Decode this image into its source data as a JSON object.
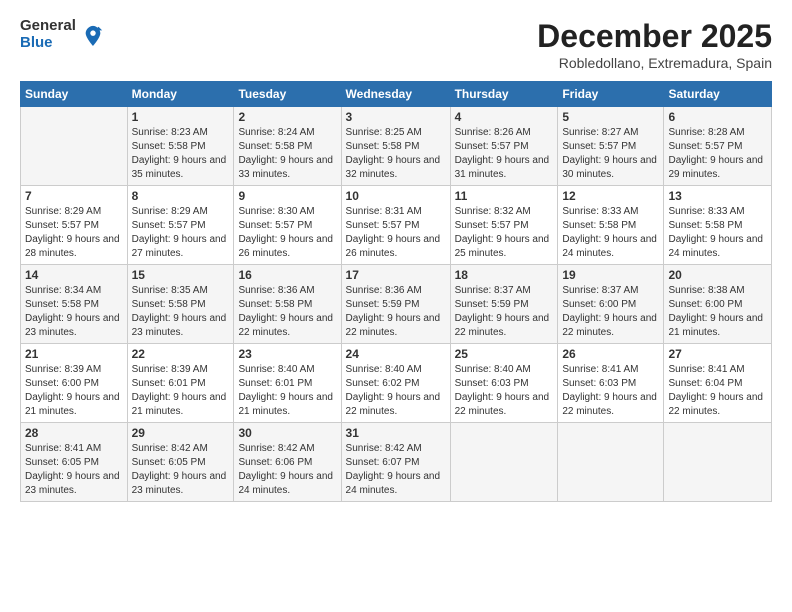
{
  "logo": {
    "general": "General",
    "blue": "Blue"
  },
  "header": {
    "month": "December 2025",
    "location": "Robledollano, Extremadura, Spain"
  },
  "weekdays": [
    "Sunday",
    "Monday",
    "Tuesday",
    "Wednesday",
    "Thursday",
    "Friday",
    "Saturday"
  ],
  "weeks": [
    [
      {
        "day": "",
        "sunrise": "",
        "sunset": "",
        "daylight": ""
      },
      {
        "day": "1",
        "sunrise": "8:23 AM",
        "sunset": "5:58 PM",
        "daylight": "9 hours and 35 minutes."
      },
      {
        "day": "2",
        "sunrise": "8:24 AM",
        "sunset": "5:58 PM",
        "daylight": "9 hours and 33 minutes."
      },
      {
        "day": "3",
        "sunrise": "8:25 AM",
        "sunset": "5:58 PM",
        "daylight": "9 hours and 32 minutes."
      },
      {
        "day": "4",
        "sunrise": "8:26 AM",
        "sunset": "5:57 PM",
        "daylight": "9 hours and 31 minutes."
      },
      {
        "day": "5",
        "sunrise": "8:27 AM",
        "sunset": "5:57 PM",
        "daylight": "9 hours and 30 minutes."
      },
      {
        "day": "6",
        "sunrise": "8:28 AM",
        "sunset": "5:57 PM",
        "daylight": "9 hours and 29 minutes."
      }
    ],
    [
      {
        "day": "7",
        "sunrise": "8:29 AM",
        "sunset": "5:57 PM",
        "daylight": "9 hours and 28 minutes."
      },
      {
        "day": "8",
        "sunrise": "8:29 AM",
        "sunset": "5:57 PM",
        "daylight": "9 hours and 27 minutes."
      },
      {
        "day": "9",
        "sunrise": "8:30 AM",
        "sunset": "5:57 PM",
        "daylight": "9 hours and 26 minutes."
      },
      {
        "day": "10",
        "sunrise": "8:31 AM",
        "sunset": "5:57 PM",
        "daylight": "9 hours and 26 minutes."
      },
      {
        "day": "11",
        "sunrise": "8:32 AM",
        "sunset": "5:57 PM",
        "daylight": "9 hours and 25 minutes."
      },
      {
        "day": "12",
        "sunrise": "8:33 AM",
        "sunset": "5:58 PM",
        "daylight": "9 hours and 24 minutes."
      },
      {
        "day": "13",
        "sunrise": "8:33 AM",
        "sunset": "5:58 PM",
        "daylight": "9 hours and 24 minutes."
      }
    ],
    [
      {
        "day": "14",
        "sunrise": "8:34 AM",
        "sunset": "5:58 PM",
        "daylight": "9 hours and 23 minutes."
      },
      {
        "day": "15",
        "sunrise": "8:35 AM",
        "sunset": "5:58 PM",
        "daylight": "9 hours and 23 minutes."
      },
      {
        "day": "16",
        "sunrise": "8:36 AM",
        "sunset": "5:58 PM",
        "daylight": "9 hours and 22 minutes."
      },
      {
        "day": "17",
        "sunrise": "8:36 AM",
        "sunset": "5:59 PM",
        "daylight": "9 hours and 22 minutes."
      },
      {
        "day": "18",
        "sunrise": "8:37 AM",
        "sunset": "5:59 PM",
        "daylight": "9 hours and 22 minutes."
      },
      {
        "day": "19",
        "sunrise": "8:37 AM",
        "sunset": "6:00 PM",
        "daylight": "9 hours and 22 minutes."
      },
      {
        "day": "20",
        "sunrise": "8:38 AM",
        "sunset": "6:00 PM",
        "daylight": "9 hours and 21 minutes."
      }
    ],
    [
      {
        "day": "21",
        "sunrise": "8:39 AM",
        "sunset": "6:00 PM",
        "daylight": "9 hours and 21 minutes."
      },
      {
        "day": "22",
        "sunrise": "8:39 AM",
        "sunset": "6:01 PM",
        "daylight": "9 hours and 21 minutes."
      },
      {
        "day": "23",
        "sunrise": "8:40 AM",
        "sunset": "6:01 PM",
        "daylight": "9 hours and 21 minutes."
      },
      {
        "day": "24",
        "sunrise": "8:40 AM",
        "sunset": "6:02 PM",
        "daylight": "9 hours and 22 minutes."
      },
      {
        "day": "25",
        "sunrise": "8:40 AM",
        "sunset": "6:03 PM",
        "daylight": "9 hours and 22 minutes."
      },
      {
        "day": "26",
        "sunrise": "8:41 AM",
        "sunset": "6:03 PM",
        "daylight": "9 hours and 22 minutes."
      },
      {
        "day": "27",
        "sunrise": "8:41 AM",
        "sunset": "6:04 PM",
        "daylight": "9 hours and 22 minutes."
      }
    ],
    [
      {
        "day": "28",
        "sunrise": "8:41 AM",
        "sunset": "6:05 PM",
        "daylight": "9 hours and 23 minutes."
      },
      {
        "day": "29",
        "sunrise": "8:42 AM",
        "sunset": "6:05 PM",
        "daylight": "9 hours and 23 minutes."
      },
      {
        "day": "30",
        "sunrise": "8:42 AM",
        "sunset": "6:06 PM",
        "daylight": "9 hours and 24 minutes."
      },
      {
        "day": "31",
        "sunrise": "8:42 AM",
        "sunset": "6:07 PM",
        "daylight": "9 hours and 24 minutes."
      },
      {
        "day": "",
        "sunrise": "",
        "sunset": "",
        "daylight": ""
      },
      {
        "day": "",
        "sunrise": "",
        "sunset": "",
        "daylight": ""
      },
      {
        "day": "",
        "sunrise": "",
        "sunset": "",
        "daylight": ""
      }
    ]
  ],
  "labels": {
    "sunrise": "Sunrise:",
    "sunset": "Sunset:",
    "daylight": "Daylight:"
  }
}
